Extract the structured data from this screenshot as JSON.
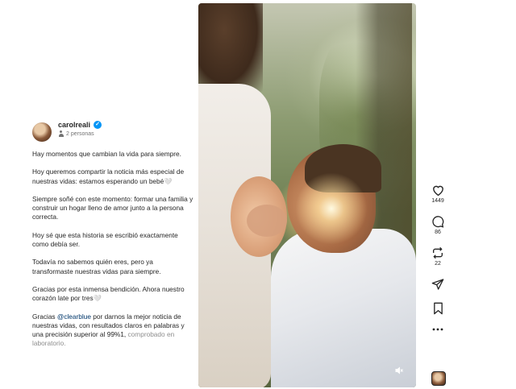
{
  "post": {
    "username": "carolreali",
    "collaborators": "2 personas",
    "caption": [
      {
        "text": "Hay momentos que cambian la vida para siempre."
      },
      {
        "text": "Hoy queremos compartir la noticia más especial de nuestras vidas: estamos esperando un bebé🤍"
      },
      {
        "text": "Siempre soñé con este momento: formar una familia y construir un hogar lleno de amor junto a la persona correcta."
      },
      {
        "text": "Hoy sé que esta historia se escribió exactamente como debía ser."
      },
      {
        "text": "Todavía no sabemos quién eres, pero ya transformaste nuestras vidas para siempre."
      },
      {
        "text": "Gracias por esta inmensa bendición. Ahora nuestro corazón late por tres🤍"
      }
    ],
    "last_paragraph": {
      "before": "Gracias ",
      "mention": "@clearblue",
      "after": " por darnos la mejor noticia de nuestras vidas, con resultados claros en palabras y una precisión superior al 99%1, ",
      "faded": "comprobado en laboratorio."
    }
  },
  "actions": {
    "likes": "1449",
    "comments": "86",
    "shares": "22"
  },
  "icons": {
    "verified": "verified-badge-icon",
    "collaborators": "person-icon",
    "like": "heart-icon",
    "comment": "comment-bubble-icon",
    "share": "repost-icon",
    "send": "send-icon",
    "save": "bookmark-icon",
    "more": "more-icon",
    "mute": "muted-speaker-icon"
  },
  "colors": {
    "text": "#262626",
    "secondary": "#737373",
    "verified": "#0095f6",
    "mention": "#00376b"
  }
}
